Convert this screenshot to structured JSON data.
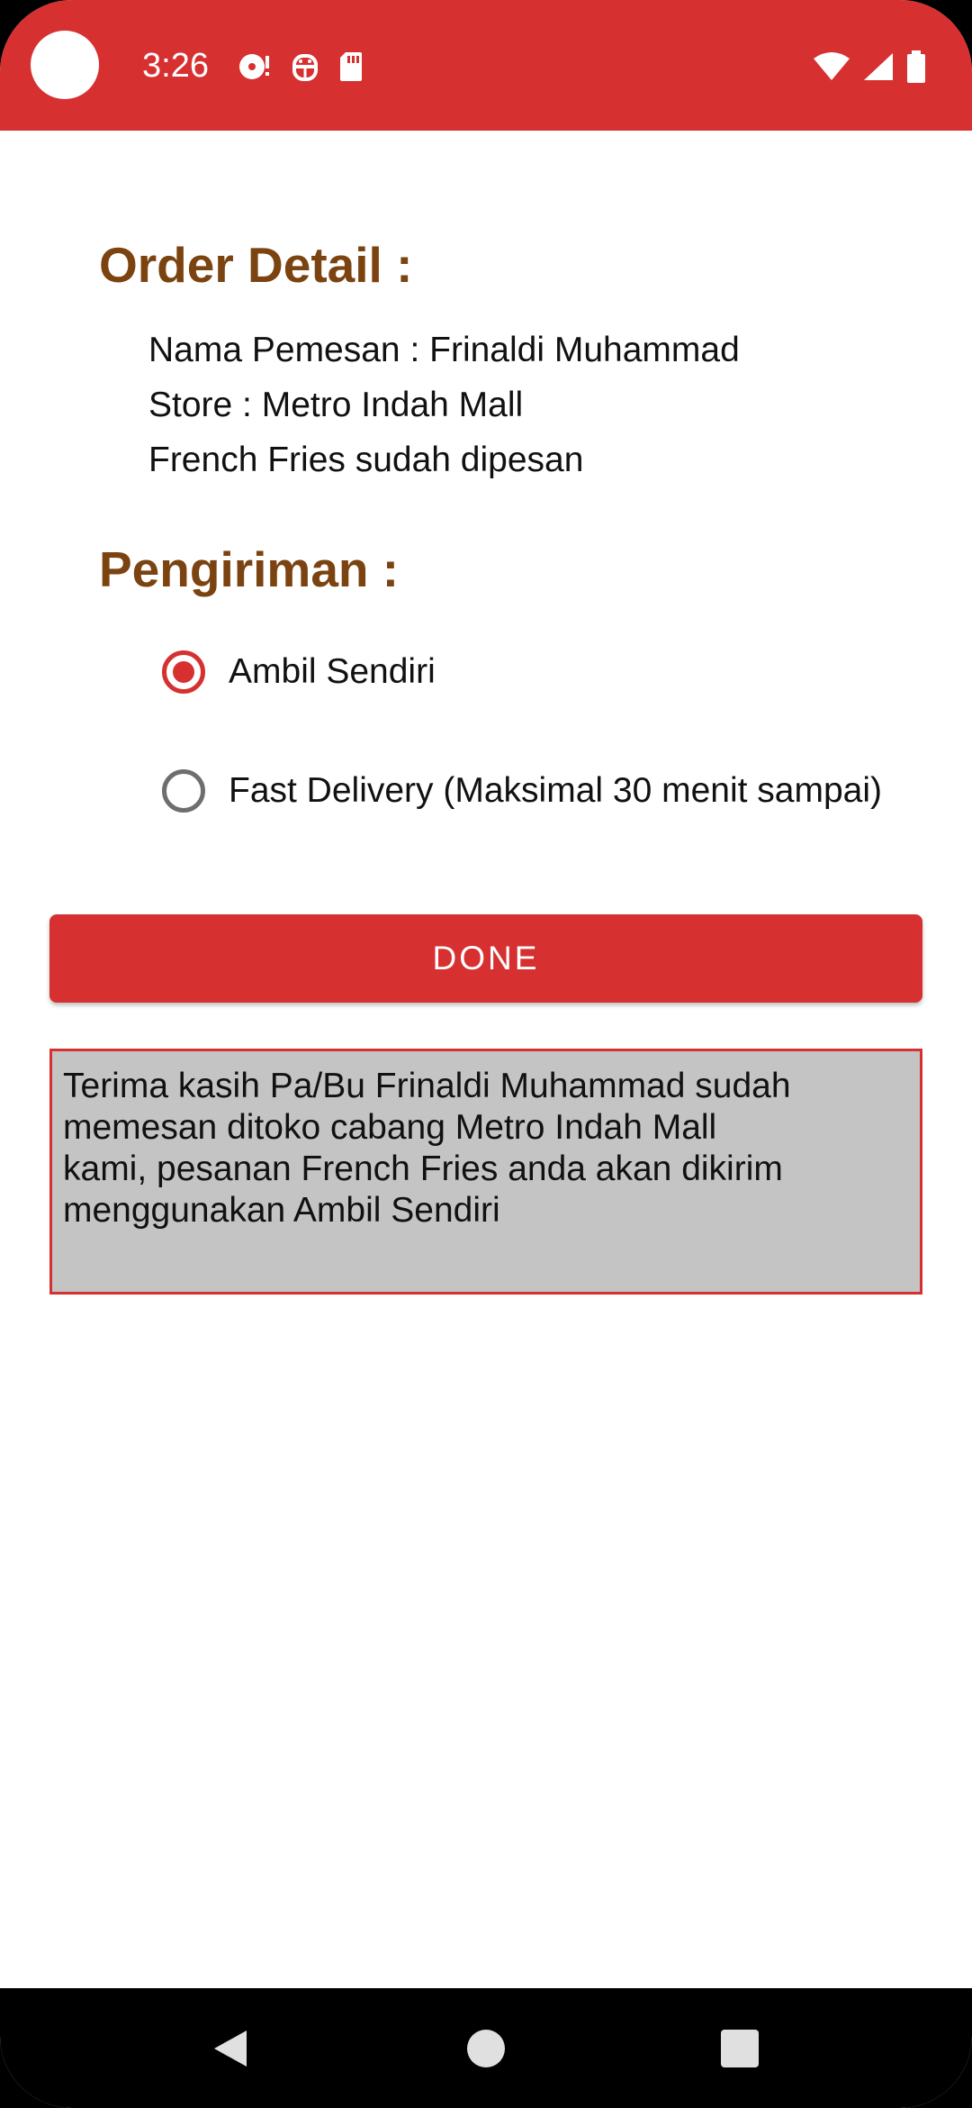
{
  "status_bar": {
    "time": "3:26",
    "left_icons": [
      "media-icon",
      "android-icon",
      "sd-card-icon"
    ],
    "right_icons": [
      "wifi-icon",
      "signal-icon",
      "battery-icon"
    ],
    "color": "#d63031"
  },
  "order_detail": {
    "title": "Order Detail :",
    "lines": [
      "Nama Pemesan : Frinaldi Muhammad",
      "Store : Metro Indah Mall",
      "French Fries sudah dipesan"
    ]
  },
  "shipping": {
    "title": "Pengiriman :",
    "options": [
      {
        "label": "Ambil Sendiri",
        "checked": true
      },
      {
        "label": "Fast Delivery (Maksimal 30 menit sampai)",
        "checked": false
      }
    ]
  },
  "done_button": {
    "label": "DONE"
  },
  "message": {
    "text": "Terima kasih Pa/Bu Frinaldi Muhammad sudah\nmemesan ditoko cabang Metro Indah Mall\nkami, pesanan French Fries anda akan dikirim\nmenggunakan Ambil Sendiri"
  },
  "nav_bar": {
    "buttons": [
      "back-icon",
      "home-icon",
      "recents-icon"
    ]
  },
  "colors": {
    "accent": "#d63031",
    "heading": "#7a4310",
    "message_bg": "#c4c4c4"
  }
}
